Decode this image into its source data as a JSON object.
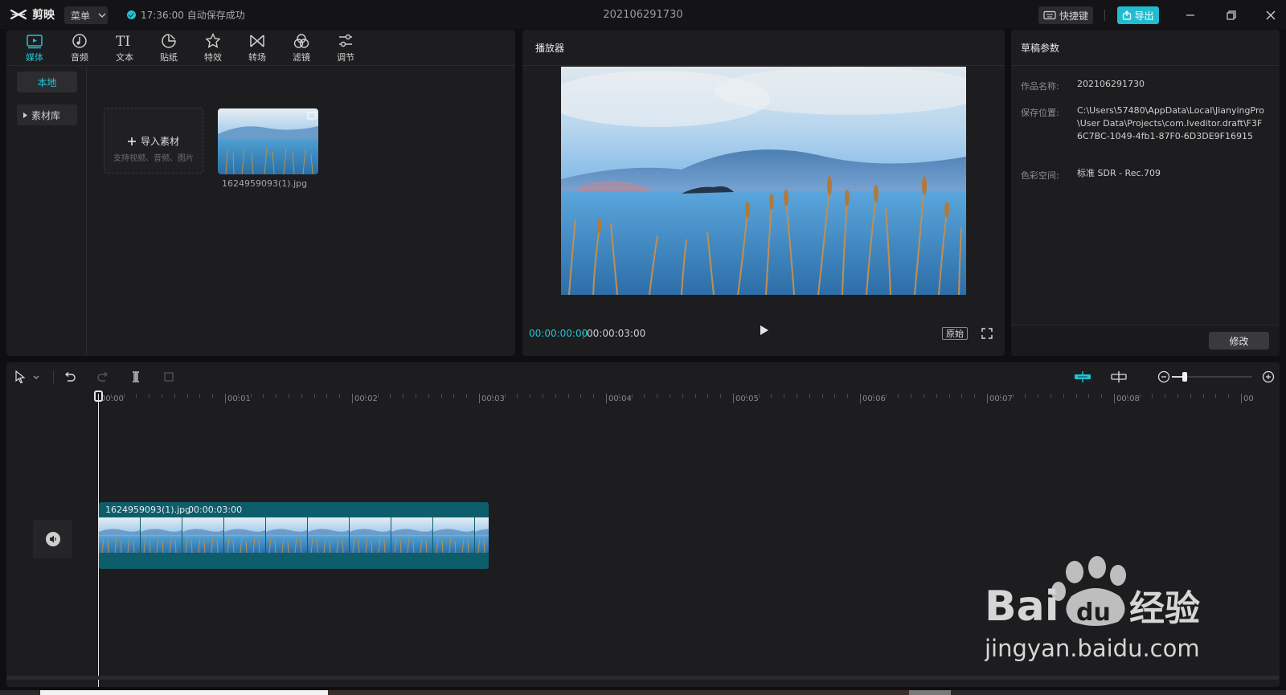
{
  "app": {
    "logo_text": "剪映",
    "menu_label": "菜单",
    "save_status": "17:36:00 自动保存成功",
    "doc_title": "202106291730",
    "shortcut_label": "快捷键",
    "export_label": "导出"
  },
  "toolbar": {
    "tools": [
      {
        "label": "媒体",
        "icon": "media-icon",
        "active": true
      },
      {
        "label": "音频",
        "icon": "audio-icon"
      },
      {
        "label": "文本",
        "icon": "text-icon"
      },
      {
        "label": "贴纸",
        "icon": "sticker-icon"
      },
      {
        "label": "特效",
        "icon": "effects-icon"
      },
      {
        "label": "转场",
        "icon": "transition-icon"
      },
      {
        "label": "滤镜",
        "icon": "filter-icon"
      },
      {
        "label": "调节",
        "icon": "adjust-icon"
      }
    ]
  },
  "media": {
    "side_local": "本地",
    "side_library": "素材库",
    "import_label": "导入素材",
    "import_hint": "支持视频、音频、图片",
    "file_name": "1624959093(1).jpg"
  },
  "player": {
    "title": "播放器",
    "current_time": "00:00:00:00",
    "separator": "|",
    "total_time": "00:00:03:00",
    "original_label": "原始"
  },
  "props": {
    "title": "草稿参数",
    "name_label": "作品名称:",
    "name_value": "202106291730",
    "path_label": "保存位置:",
    "path_value": "C:\\Users\\57480\\AppData\\Local\\JianyingPro\\User Data\\Projects\\com.lveditor.draft\\F3F6C7BC-1049-4fb1-87F0-6D3DE9F16915",
    "color_label": "色彩空间:",
    "color_value": "标准 SDR - Rec.709",
    "edit_label": "修改"
  },
  "timeline": {
    "ticks": [
      "00:00",
      "00:01",
      "00:02",
      "00:03",
      "00:04",
      "00:05",
      "00:06",
      "00:07",
      "00:08",
      "00"
    ],
    "clip_name": "1624959093(1).jpg",
    "clip_duration": "00:00:03:00",
    "zoom_level": 0.16
  },
  "watermark": {
    "brand_text": "Bai",
    "brand_text2": "经验",
    "url": "jingyan.baidu.com"
  },
  "colors": {
    "accent": "#21c3d4",
    "clip": "#0e5d6b",
    "track_marker": "#e07a2c"
  }
}
